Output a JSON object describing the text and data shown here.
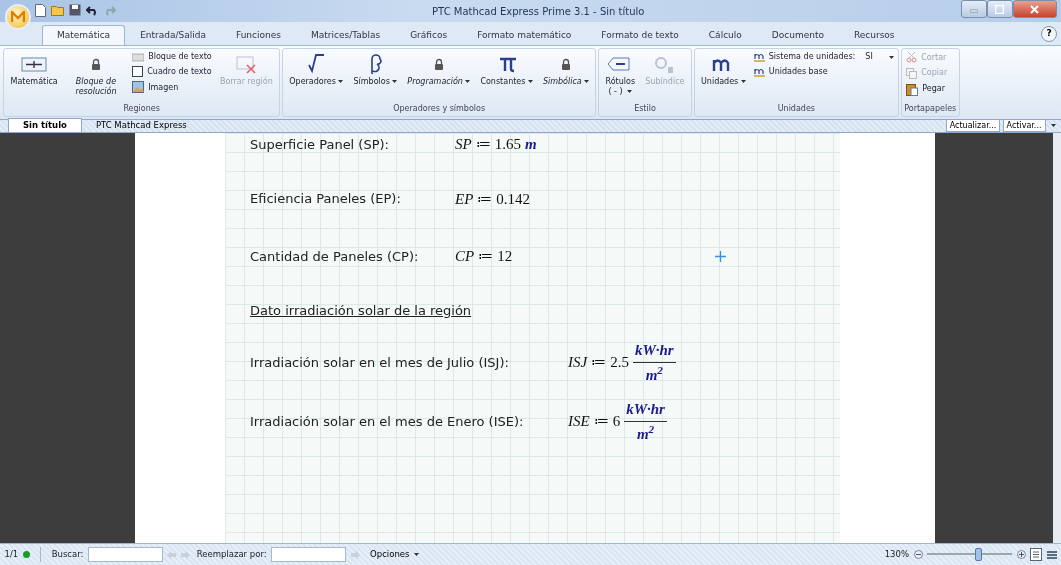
{
  "window": {
    "title": "PTC Mathcad Express Prime 3.1 - Sin título"
  },
  "menu_tabs": [
    {
      "label": "Matemática",
      "selected": true
    },
    {
      "label": "Entrada/Salida",
      "selected": false
    },
    {
      "label": "Funciones",
      "selected": false
    },
    {
      "label": "Matrices/Tablas",
      "selected": false
    },
    {
      "label": "Gráficos",
      "selected": false
    },
    {
      "label": "Formato matemático",
      "selected": false
    },
    {
      "label": "Formato de texto",
      "selected": false
    },
    {
      "label": "Cálculo",
      "selected": false
    },
    {
      "label": "Documento",
      "selected": false
    },
    {
      "label": "Recursos",
      "selected": false
    }
  ],
  "help": "?",
  "ribbon": [
    {
      "label": "Regiones",
      "items": [
        {
          "label": "Matemática",
          "kind": "large",
          "disabled": false,
          "locked": false,
          "dropdown": false
        },
        {
          "label": "Bloque de resolución",
          "kind": "large",
          "disabled": false,
          "locked": true,
          "dropdown": false
        },
        {
          "label": "Bloque de texto",
          "kind": "small",
          "disabled": false,
          "locked": false,
          "dropdown": false
        },
        {
          "label": "Cuadro de texto",
          "kind": "small",
          "disabled": false,
          "locked": false,
          "dropdown": false
        },
        {
          "label": "Imagen",
          "kind": "small",
          "disabled": false,
          "locked": false,
          "dropdown": false
        },
        {
          "label": "Borrar región",
          "kind": "large",
          "disabled": true,
          "locked": false,
          "dropdown": false
        }
      ]
    },
    {
      "label": "Operadores y símbolos",
      "items": [
        {
          "label": "Operadores",
          "kind": "large",
          "disabled": false,
          "locked": false,
          "dropdown": true
        },
        {
          "label": "Símbolos",
          "kind": "large",
          "disabled": false,
          "locked": false,
          "dropdown": true
        },
        {
          "label": "Programación",
          "kind": "large",
          "disabled": false,
          "locked": true,
          "dropdown": true
        },
        {
          "label": "Constantes",
          "kind": "large",
          "disabled": false,
          "locked": false,
          "dropdown": true
        },
        {
          "label": "Simbólica",
          "kind": "large",
          "disabled": false,
          "locked": true,
          "dropdown": true
        }
      ]
    },
    {
      "label": "Estilo",
      "items": [
        {
          "label": "Rótulos",
          "sub": "( - )",
          "kind": "large",
          "disabled": false,
          "locked": false,
          "dropdown": true
        },
        {
          "label": "Subíndice",
          "kind": "large",
          "disabled": true,
          "locked": false,
          "dropdown": false
        }
      ]
    },
    {
      "label": "Unidades",
      "items": [
        {
          "label": "Unidades",
          "kind": "large",
          "disabled": false,
          "locked": false,
          "dropdown": true
        },
        {
          "label": "Sistema de unidades:",
          "value": "SI",
          "kind": "small",
          "disabled": false,
          "locked": false,
          "dropdown": true
        },
        {
          "label": "Unidades base",
          "kind": "small",
          "disabled": false,
          "locked": false,
          "dropdown": false
        }
      ]
    },
    {
      "label": "Portapapeles",
      "items": [
        {
          "label": "Cortar",
          "kind": "small",
          "disabled": true,
          "locked": false,
          "dropdown": false
        },
        {
          "label": "Copiar",
          "kind": "small",
          "disabled": true,
          "locked": false,
          "dropdown": false
        },
        {
          "label": "Pegar",
          "kind": "small",
          "disabled": false,
          "locked": false,
          "dropdown": false
        }
      ]
    }
  ],
  "doc_tabs": [
    {
      "label": "Sin título",
      "selected": true
    },
    {
      "label": "PTC Mathcad Express",
      "selected": false
    }
  ],
  "doc_buttons": [
    "Actualizar...",
    "Activar..."
  ],
  "worksheet": {
    "sections": [
      {
        "rows": [
          {
            "label": "Superficie Panel (SP):",
            "variable": "SP",
            "operator": "≔",
            "value": "1.65",
            "unit": "m"
          },
          {
            "label": "Eficiencia Paneles (EP):",
            "variable": "EP",
            "operator": "≔",
            "value": "0.142"
          },
          {
            "label": "Cantidad de Paneles (CP):",
            "variable": "CP",
            "operator": "≔",
            "value": "12"
          }
        ]
      },
      {
        "heading": "Dato irradiación solar de la región",
        "rows": [
          {
            "label": "Irradiación solar en el mes de Julio (ISJ):",
            "variable": "ISJ",
            "operator": "≔",
            "value": "2.5",
            "unit_fraction": {
              "numerator": "kW·hr",
              "denominator": "m$^{2}$"
            }
          },
          {
            "label": "Irradiación solar en el mes de Enero (ISE):",
            "variable": "ISE",
            "operator": "≔",
            "value": "6",
            "unit_fraction": {
              "numerator": "kW·hr",
              "denominator": "m$^{2}$"
            }
          }
        ]
      }
    ]
  },
  "status_bar": {
    "page": "1/1",
    "search_label": "Buscar:",
    "replace_label": "Reemplazar por:",
    "options": "Opciones",
    "zoom": "130%",
    "zoom_slider": {
      "level": 0.6
    }
  }
}
